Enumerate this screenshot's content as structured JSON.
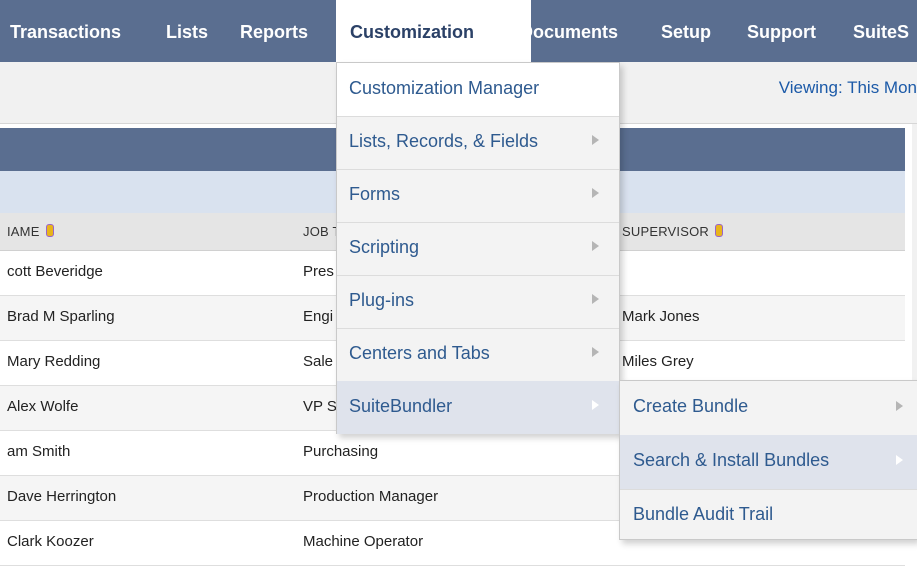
{
  "nav": {
    "items": [
      "Transactions",
      "Lists",
      "Reports",
      "Customization",
      "Documents",
      "Setup",
      "Support",
      "SuiteS"
    ],
    "active_index": 3
  },
  "toolbar": {
    "viewing": "Viewing: This Mon"
  },
  "table": {
    "headers": [
      "IAME",
      "JOB T",
      "SUPERVISOR"
    ],
    "rows": [
      {
        "name": "cott Beveridge",
        "job": "Pres",
        "supervisor": ""
      },
      {
        "name": "Brad M Sparling",
        "job": "Engi",
        "supervisor": "Mark Jones"
      },
      {
        "name": "Mary Redding",
        "job": "Sale",
        "supervisor": "Miles Grey"
      },
      {
        "name": "Alex Wolfe",
        "job": "VP S",
        "supervisor": ""
      },
      {
        "name": "am Smith",
        "job": "Purchasing",
        "supervisor": ""
      },
      {
        "name": "Dave Herrington",
        "job": "Production Manager",
        "supervisor": ""
      },
      {
        "name": "Clark Koozer",
        "job": "Machine Operator",
        "supervisor": ""
      }
    ]
  },
  "menu": {
    "items": [
      {
        "label": "Customization Manager",
        "has_submenu": false
      },
      {
        "label": "Lists, Records, & Fields",
        "has_submenu": true
      },
      {
        "label": "Forms",
        "has_submenu": true
      },
      {
        "label": "Scripting",
        "has_submenu": true
      },
      {
        "label": "Plug-ins",
        "has_submenu": true
      },
      {
        "label": "Centers and Tabs",
        "has_submenu": true
      },
      {
        "label": "SuiteBundler",
        "has_submenu": true,
        "highlighted": true
      }
    ]
  },
  "submenu": {
    "items": [
      {
        "label": "Create Bundle",
        "has_submenu": true
      },
      {
        "label": "Search & Install Bundles",
        "has_submenu": true,
        "highlighted": true
      },
      {
        "label": "Bundle Audit Trail",
        "has_submenu": false
      }
    ]
  },
  "colors": {
    "nav_bg": "#5a6e90",
    "menu_link": "#2e5a8f",
    "menu_hover": "#dfe3ec",
    "viewing_link": "#1c5aa8"
  }
}
